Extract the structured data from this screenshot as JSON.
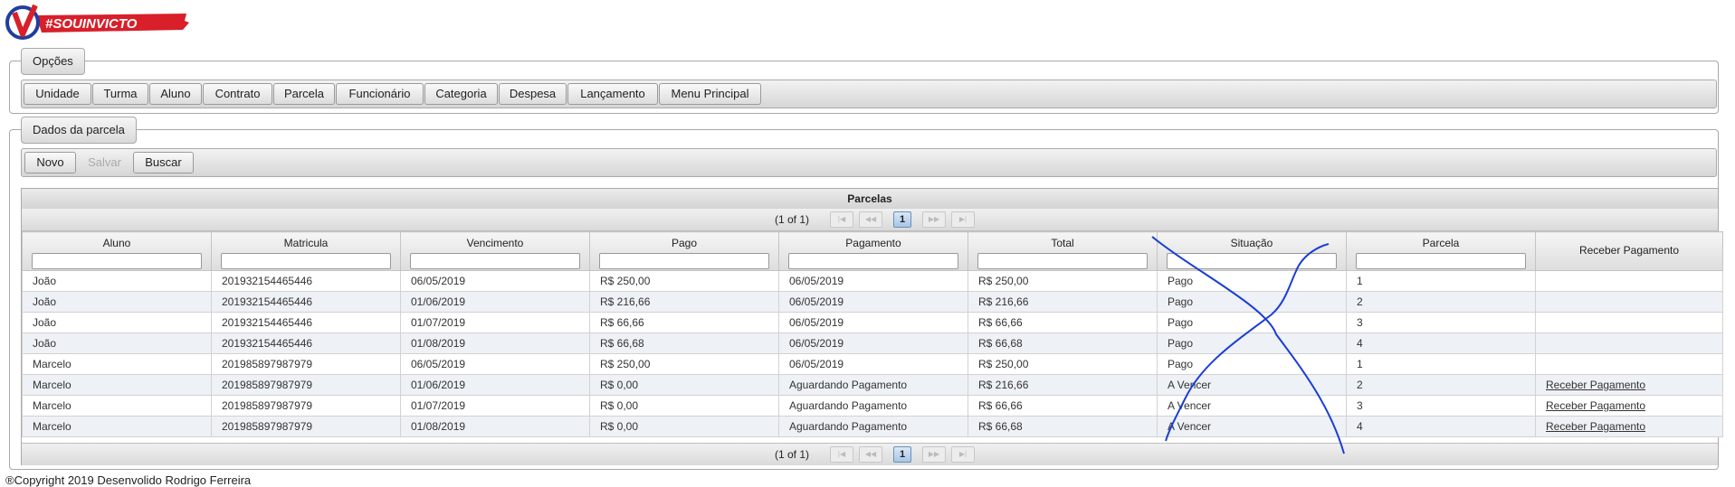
{
  "logo": {
    "text": "#SOUINVICTO",
    "mark": "V"
  },
  "opcoes": {
    "legend": "Opções",
    "menu": [
      "Unidade",
      "Turma",
      "Aluno",
      "Contrato",
      "Parcela",
      "Funcionário",
      "Categoria",
      "Despesa",
      "Lançamento",
      "Menu Principal"
    ]
  },
  "dados": {
    "legend": "Dados da parcela",
    "buttons": {
      "novo": "Novo",
      "salvar": "Salvar",
      "buscar": "Buscar"
    }
  },
  "panel": {
    "title": "Parcelas",
    "report": "(1 of 1)",
    "page": "1",
    "columns": [
      "Aluno",
      "Matricula",
      "Vencimento",
      "Pago",
      "Pagamento",
      "Total",
      "Situação",
      "Parcela",
      "Receber Pagamento"
    ],
    "rows": [
      [
        "João",
        "201932154465446",
        "06/05/2019",
        "R$ 250,00",
        "06/05/2019",
        "R$ 250,00",
        "Pago",
        "1",
        ""
      ],
      [
        "João",
        "201932154465446",
        "01/06/2019",
        "R$ 216,66",
        "06/05/2019",
        "R$ 216,66",
        "Pago",
        "2",
        ""
      ],
      [
        "João",
        "201932154465446",
        "01/07/2019",
        "R$ 66,66",
        "06/05/2019",
        "R$ 66,66",
        "Pago",
        "3",
        ""
      ],
      [
        "João",
        "201932154465446",
        "01/08/2019",
        "R$ 66,68",
        "06/05/2019",
        "R$ 66,68",
        "Pago",
        "4",
        ""
      ],
      [
        "Marcelo",
        "201985897987979",
        "06/05/2019",
        "R$ 250,00",
        "06/05/2019",
        "R$ 250,00",
        "Pago",
        "1",
        ""
      ],
      [
        "Marcelo",
        "201985897987979",
        "01/06/2019",
        "R$ 0,00",
        "Aguardando Pagamento",
        "R$ 216,66",
        "A Vencer",
        "2",
        "Receber Pagamento"
      ],
      [
        "Marcelo",
        "201985897987979",
        "01/07/2019",
        "R$ 0,00",
        "Aguardando Pagamento",
        "R$ 66,66",
        "A Vencer",
        "3",
        "Receber Pagamento"
      ],
      [
        "Marcelo",
        "201985897987979",
        "01/08/2019",
        "R$ 0,00",
        "Aguardando Pagamento",
        "R$ 66,68",
        "A Vencer",
        "4",
        "Receber Pagamento"
      ]
    ]
  },
  "footer": {
    "copyright": "®Copyright 2019 Desenvolido Rodrigo Ferreira"
  },
  "colors": {
    "accent_blue": "#1a3dd6",
    "logo_red": "#d81f2a",
    "logo_blue": "#1f3f9e"
  }
}
